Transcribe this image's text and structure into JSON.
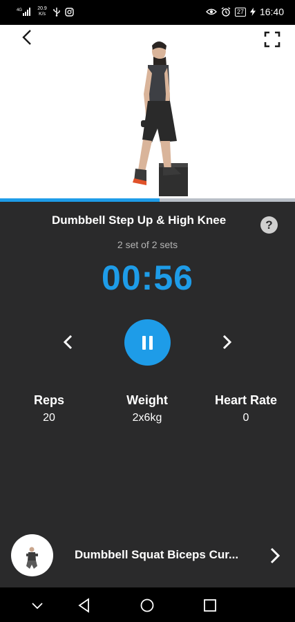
{
  "status_bar": {
    "network": "4G",
    "speed_value": "20.9",
    "speed_unit": "K/s",
    "battery": "27",
    "time": "16:40"
  },
  "video": {
    "progress_fraction": 0.54
  },
  "exercise": {
    "title": "Dumbbell Step Up & High Knee",
    "help_label": "?",
    "set_info": "2 set of 2 sets",
    "timer": "00:56"
  },
  "stats": {
    "reps": {
      "label": "Reps",
      "value": "20"
    },
    "weight": {
      "label": "Weight",
      "value": "2x6kg"
    },
    "heart_rate": {
      "label": "Heart Rate",
      "value": "0"
    }
  },
  "next_exercise": {
    "title": "Dumbbell Squat Biceps Cur..."
  },
  "colors": {
    "accent": "#1e9ce8",
    "background": "#2a2a2b"
  },
  "icons": {
    "back": "chevron-left-icon",
    "fullscreen": "fullscreen-icon",
    "help": "help-icon",
    "prev": "chevron-left-icon",
    "pause": "pause-icon",
    "next": "chevron-right-icon",
    "nav_hide": "chevron-down-icon",
    "nav_back": "triangle-back-icon",
    "nav_home": "circle-home-icon",
    "nav_recent": "square-recent-icon"
  }
}
